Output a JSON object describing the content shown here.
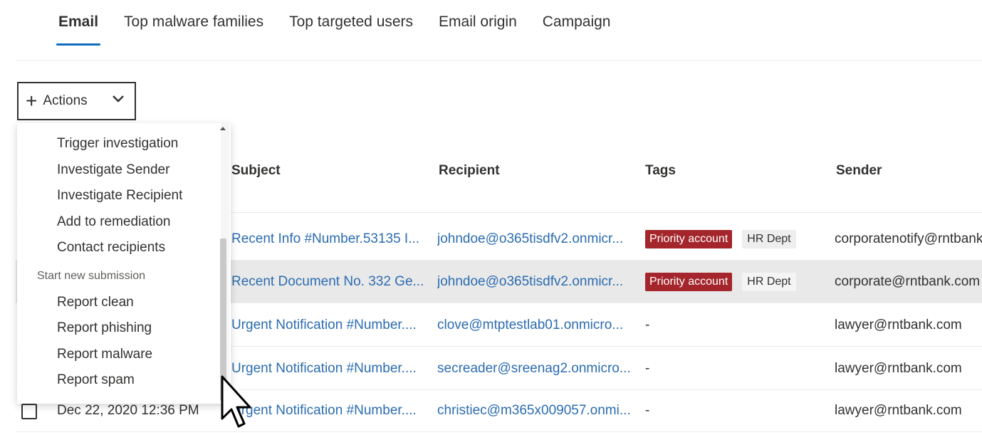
{
  "tabs": [
    {
      "label": "Email",
      "active": true
    },
    {
      "label": "Top malware families",
      "active": false
    },
    {
      "label": "Top targeted users",
      "active": false
    },
    {
      "label": "Email origin",
      "active": false
    },
    {
      "label": "Campaign",
      "active": false
    }
  ],
  "actions": {
    "label": "Actions",
    "plus_icon": "plus-icon",
    "chevron_icon": "chevron-down-icon"
  },
  "menu": {
    "items_group1": [
      "Trigger investigation",
      "Investigate Sender",
      "Investigate Recipient",
      "Add to remediation",
      "Contact recipients"
    ],
    "section_label": "Start new submission",
    "items_group2": [
      "Report clean",
      "Report phishing",
      "Report malware",
      "Report spam"
    ]
  },
  "table": {
    "headers": {
      "subject": "Subject",
      "recipient": "Recipient",
      "tags": "Tags",
      "sender": "Sender"
    },
    "rows": [
      {
        "subject": "Recent Info #Number.53135 I...",
        "recipient": "johndoe@o365tisdfv2.onmicr...",
        "tags": [
          "Priority account",
          "HR Dept"
        ],
        "sender": "corporatenotify@rntbank.com",
        "selected": false
      },
      {
        "subject": "Recent Document No. 332 Ge...",
        "recipient": "johndoe@o365tisdfv2.onmicr...",
        "tags": [
          "Priority account",
          "HR Dept"
        ],
        "sender": "corporate@rntbank.com",
        "selected": true
      },
      {
        "subject": "Urgent Notification #Number....",
        "recipient": "clove@mtptestlab01.onmicro...",
        "tags_text": "-",
        "sender": "lawyer@rntbank.com",
        "selected": false
      },
      {
        "subject": "Urgent Notification #Number....",
        "recipient": "secreader@sreenag2.onmicro...",
        "tags_text": "-",
        "sender": "lawyer@rntbank.com",
        "selected": false
      },
      {
        "date": "Dec 22, 2020 12:36 PM",
        "subject": "Urgent Notification #Number....",
        "recipient": "christiec@m365x009057.onmi...",
        "tags_text": "-",
        "sender": "lawyer@rntbank.com",
        "selected": false
      }
    ]
  },
  "colors": {
    "accent": "#0f6cbd",
    "link": "#2b6cb0",
    "priority_tag": "#a4262c",
    "selected_row": "#e9e9e9"
  },
  "cursor": "arrow-cursor-icon"
}
